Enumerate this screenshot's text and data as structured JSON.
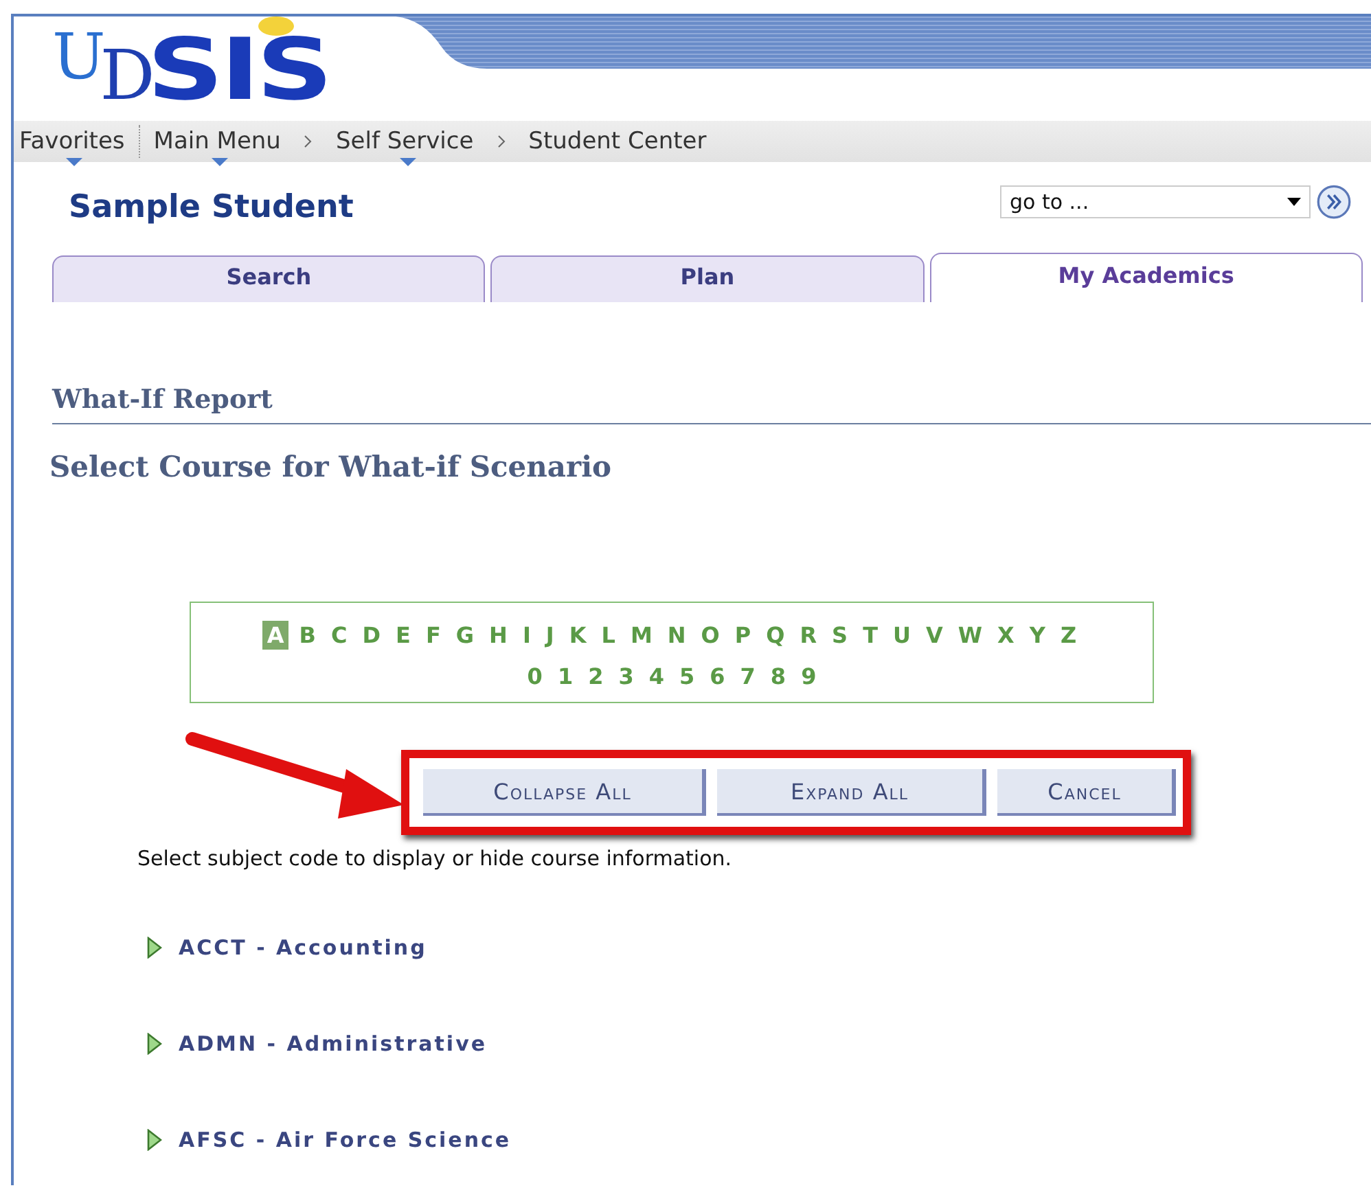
{
  "logo": {
    "mark_u": "U",
    "mark_d": "D",
    "word": "SIS"
  },
  "nav": [
    {
      "label": "Favorites",
      "menu": true
    },
    {
      "label": "Main Menu",
      "menu": true
    },
    {
      "label": "Self Service",
      "menu": true
    },
    {
      "label": "Student Center",
      "menu": false
    }
  ],
  "student_name": "Sample Student",
  "goto": {
    "value": "go to ..."
  },
  "tabs": [
    {
      "label": "Search",
      "selected": false
    },
    {
      "label": "Plan",
      "selected": false
    },
    {
      "label": "My Academics",
      "selected": true
    }
  ],
  "report_title": "What-If Report",
  "page_title": "Select Course for What-if Scenario",
  "letters": [
    {
      "label": "A",
      "selected": true
    },
    {
      "label": "B",
      "selected": false
    },
    {
      "label": "C",
      "selected": false
    },
    {
      "label": "D",
      "selected": false
    },
    {
      "label": "E",
      "selected": false
    },
    {
      "label": "F",
      "selected": false
    },
    {
      "label": "G",
      "selected": false
    },
    {
      "label": "H",
      "selected": false
    },
    {
      "label": "I",
      "selected": false
    },
    {
      "label": "J",
      "selected": false
    },
    {
      "label": "K",
      "selected": false
    },
    {
      "label": "L",
      "selected": false
    },
    {
      "label": "M",
      "selected": false
    },
    {
      "label": "N",
      "selected": false
    },
    {
      "label": "O",
      "selected": false
    },
    {
      "label": "P",
      "selected": false
    },
    {
      "label": "Q",
      "selected": false
    },
    {
      "label": "R",
      "selected": false
    },
    {
      "label": "S",
      "selected": false
    },
    {
      "label": "T",
      "selected": false
    },
    {
      "label": "U",
      "selected": false
    },
    {
      "label": "V",
      "selected": false
    },
    {
      "label": "W",
      "selected": false
    },
    {
      "label": "X",
      "selected": false
    },
    {
      "label": "Y",
      "selected": false
    },
    {
      "label": "Z",
      "selected": false
    }
  ],
  "digits": [
    {
      "label": "0",
      "selected": false
    },
    {
      "label": "1",
      "selected": false
    },
    {
      "label": "2",
      "selected": false
    },
    {
      "label": "3",
      "selected": false
    },
    {
      "label": "4",
      "selected": false
    },
    {
      "label": "5",
      "selected": false
    },
    {
      "label": "6",
      "selected": false
    },
    {
      "label": "7",
      "selected": false
    },
    {
      "label": "8",
      "selected": false
    },
    {
      "label": "9",
      "selected": false
    }
  ],
  "buttons": [
    "Collapse All",
    "Expand All",
    "Cancel"
  ],
  "instruction": "Select subject code to display or hide course information.",
  "subjects": [
    {
      "label": "ACCT - Accounting",
      "expanded": false
    },
    {
      "label": "ADMN - Administrative",
      "expanded": false
    },
    {
      "label": "AFSC - Air Force Science",
      "expanded": false
    }
  ]
}
